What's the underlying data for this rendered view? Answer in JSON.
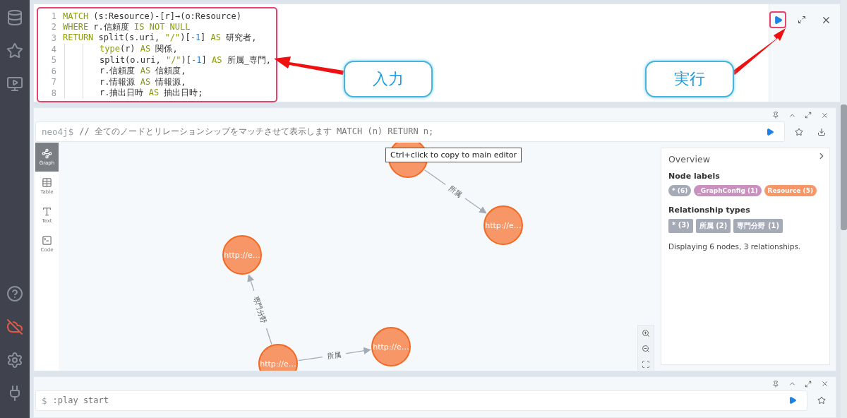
{
  "editor": {
    "lines": [
      {
        "number": "1",
        "indented": false,
        "tokens": [
          {
            "kind": "keyword",
            "text": "MATCH"
          },
          {
            "kind": "plain",
            "text": " (s:Resource)-[r]→(o:Resource)"
          }
        ]
      },
      {
        "number": "2",
        "indented": false,
        "tokens": [
          {
            "kind": "keyword",
            "text": "WHERE"
          },
          {
            "kind": "plain",
            "text": " r.信頼度 "
          },
          {
            "kind": "keyword",
            "text": "IS NOT NULL"
          }
        ]
      },
      {
        "number": "3",
        "indented": false,
        "tokens": [
          {
            "kind": "keyword",
            "text": "RETURN"
          },
          {
            "kind": "plain",
            "text": " split(s.uri, "
          },
          {
            "kind": "string",
            "text": "\"/\""
          },
          {
            "kind": "plain",
            "text": ")["
          },
          {
            "kind": "number",
            "text": "-1"
          },
          {
            "kind": "plain",
            "text": "] "
          },
          {
            "kind": "keyword",
            "text": "AS"
          },
          {
            "kind": "plain",
            "text": " 研究者,"
          }
        ]
      },
      {
        "number": "4",
        "indented": true,
        "tokens": [
          {
            "kind": "keyword",
            "text": "type"
          },
          {
            "kind": "plain",
            "text": "(r) "
          },
          {
            "kind": "keyword",
            "text": "AS"
          },
          {
            "kind": "plain",
            "text": " 関係,"
          }
        ]
      },
      {
        "number": "5",
        "indented": true,
        "tokens": [
          {
            "kind": "plain",
            "text": "split(o.uri, "
          },
          {
            "kind": "string",
            "text": "\"/\""
          },
          {
            "kind": "plain",
            "text": ")["
          },
          {
            "kind": "number",
            "text": "-1"
          },
          {
            "kind": "plain",
            "text": "] "
          },
          {
            "kind": "keyword",
            "text": "AS"
          },
          {
            "kind": "plain",
            "text": " 所属_専門,"
          }
        ]
      },
      {
        "number": "6",
        "indented": true,
        "tokens": [
          {
            "kind": "plain",
            "text": "r.信頼度 "
          },
          {
            "kind": "keyword",
            "text": "AS"
          },
          {
            "kind": "plain",
            "text": " 信頼度,"
          }
        ]
      },
      {
        "number": "7",
        "indented": true,
        "tokens": [
          {
            "kind": "plain",
            "text": "r.情報源 "
          },
          {
            "kind": "keyword",
            "text": "AS"
          },
          {
            "kind": "plain",
            "text": " 情報源,"
          }
        ]
      },
      {
        "number": "8",
        "indented": true,
        "tokens": [
          {
            "kind": "plain",
            "text": "r.抽出日時 "
          },
          {
            "kind": "keyword",
            "text": "AS"
          },
          {
            "kind": "plain",
            "text": " 抽出日時;"
          }
        ]
      }
    ]
  },
  "annotations": [
    {
      "text": "入力"
    },
    {
      "text": "実行"
    }
  ],
  "result": {
    "prompt": "neo4j$",
    "query": "// 全てのノードとリレーションシップをマッチさせて表示します MATCH (n) RETURN n;",
    "view_tabs": [
      {
        "label": "Graph",
        "selected": true
      },
      {
        "label": "Table",
        "selected": false
      },
      {
        "label": "Text",
        "selected": false
      },
      {
        "label": "Code",
        "selected": false
      }
    ],
    "tooltip": "Ctrl+click to copy to main editor",
    "graph": {
      "nodes": [
        {
          "kind": "resource"
        },
        {
          "kind": "resource",
          "label": "http://e…"
        },
        {
          "kind": "resource",
          "label": "http://e…"
        },
        {
          "kind": "resource",
          "label": "http://e…"
        },
        {
          "kind": "resource",
          "label": "http://e…"
        }
      ],
      "edges": [
        {
          "label": "所属"
        },
        {
          "label": "専門分野"
        },
        {
          "label": "所属"
        }
      ]
    },
    "overview": {
      "title": "Overview",
      "node_labels_heading": "Node labels",
      "node_labels": [
        {
          "text": "* (6)",
          "color": "#a5abb6"
        },
        {
          "text": "_GraphConfig (1)",
          "color": "#c990c0"
        },
        {
          "text": "Resource (5)",
          "color": "#f79767"
        }
      ],
      "relationship_types_heading": "Relationship types",
      "relationship_types": [
        {
          "text": "* (3)"
        },
        {
          "text": "所属 (2)"
        },
        {
          "text": "専門分野 (1)"
        }
      ],
      "summary": "Displaying 6 nodes, 3 relationships."
    }
  },
  "next_frame": {
    "prompt": "$",
    "query": ":play start"
  }
}
